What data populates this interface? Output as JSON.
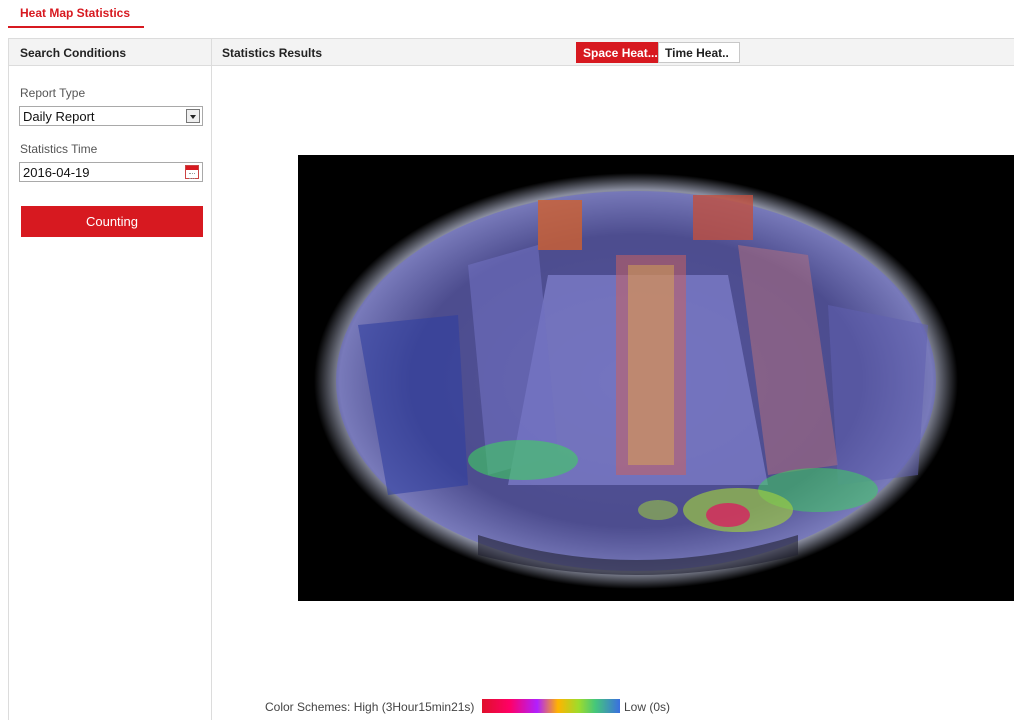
{
  "page_tab": {
    "label": "Heat Map Statistics"
  },
  "search_panel": {
    "title": "Search Conditions",
    "report_type_label": "Report Type",
    "report_type_value": "Daily Report",
    "statistics_time_label": "Statistics Time",
    "statistics_time_value": "2016-04-19",
    "counting_button": "Counting"
  },
  "results_panel": {
    "title": "Statistics Results",
    "view_tabs": [
      {
        "label": "Space Heat...",
        "active": true
      },
      {
        "label": "Time Heat..",
        "active": false
      }
    ]
  },
  "legend": {
    "prefix": "Color Schemes:  High (3Hour15min21s)",
    "low_label": "Low (0s)"
  },
  "colors": {
    "accent": "#d71920",
    "header_bg": "#f3f3f3",
    "heat_low": "#5a5ae0",
    "heat_mid": "#3fd060",
    "heat_high": "#d72060"
  },
  "icons": {
    "dropdown": "chevron-down-icon",
    "calendar": "calendar-icon"
  }
}
